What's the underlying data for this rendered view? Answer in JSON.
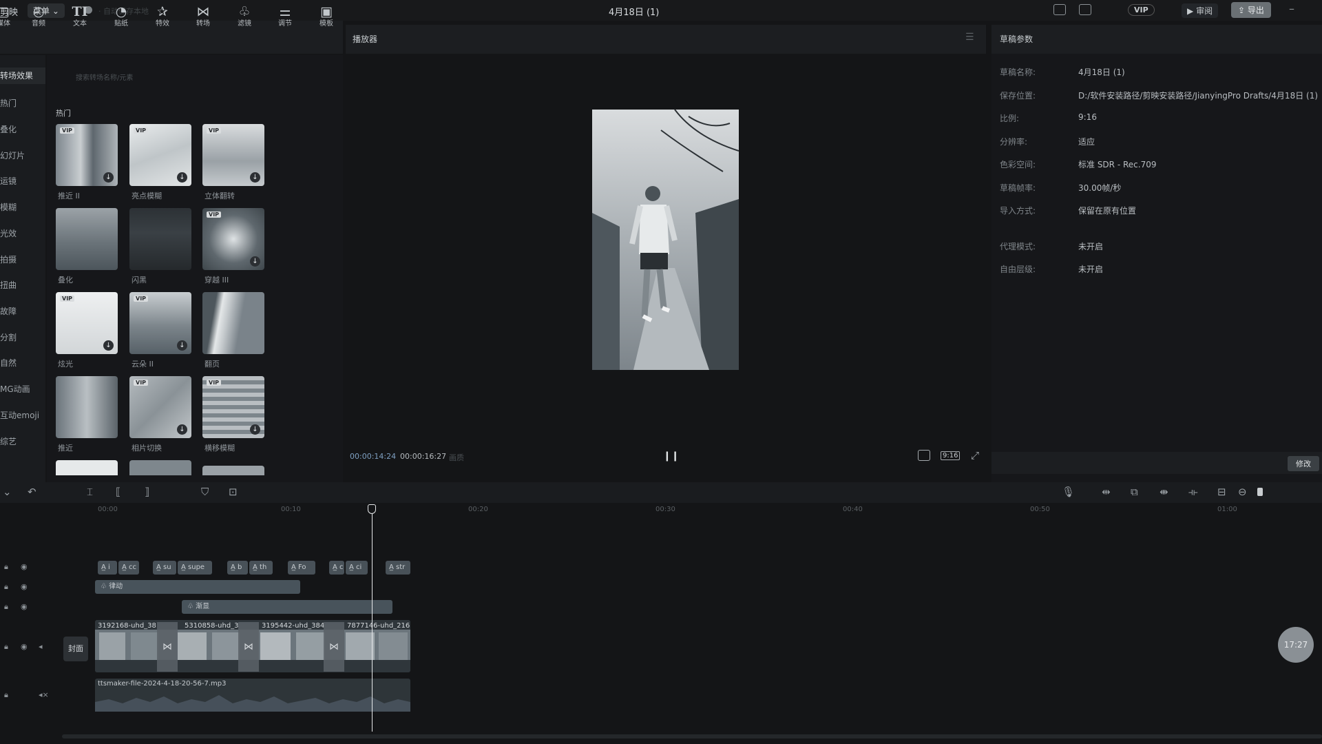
{
  "titlebar": {
    "app_name": "剪映",
    "menu_label": "菜单",
    "status": "· 自动保存本地",
    "project_title": "4月18日 (1)",
    "vip": "VIP",
    "review": "审阅",
    "export": "导出"
  },
  "toolbar": {
    "items": [
      {
        "label": "媒体",
        "icon": "media-icon"
      },
      {
        "label": "音频",
        "icon": "audio-icon"
      },
      {
        "label": "文本",
        "icon": "text-icon"
      },
      {
        "label": "贴纸",
        "icon": "sticker-icon"
      },
      {
        "label": "特效",
        "icon": "effects-icon"
      },
      {
        "label": "转场",
        "icon": "transition-icon"
      },
      {
        "label": "滤镜",
        "icon": "filter-icon"
      },
      {
        "label": "调节",
        "icon": "adjust-icon"
      },
      {
        "label": "模板",
        "icon": "template-icon"
      }
    ]
  },
  "sidebar": {
    "items": [
      "转场效果",
      "热门",
      "叠化",
      "幻灯片",
      "运镜",
      "模糊",
      "光效",
      "拍摄",
      "扭曲",
      "故障",
      "分割",
      "自然",
      "MG动画",
      "互动emoji",
      "综艺"
    ]
  },
  "transitions": {
    "search_hint": "搜索转场名称/元素",
    "section_title": "热门",
    "vip_badge": "VIP",
    "items": [
      {
        "label": "推近 II",
        "vip": true,
        "download": true
      },
      {
        "label": "亮点模糊",
        "vip": true,
        "download": true
      },
      {
        "label": "立体翻转",
        "vip": true,
        "download": true
      },
      {
        "label": "叠化",
        "vip": false,
        "download": false
      },
      {
        "label": "闪黑",
        "vip": false,
        "download": false
      },
      {
        "label": "穿越 III",
        "vip": true,
        "download": true
      },
      {
        "label": "炫光",
        "vip": true,
        "download": true
      },
      {
        "label": "云朵 II",
        "vip": true,
        "download": true
      },
      {
        "label": "翻页",
        "vip": false,
        "download": false
      },
      {
        "label": "推近",
        "vip": false,
        "download": false
      },
      {
        "label": "相片切换",
        "vip": true,
        "download": true
      },
      {
        "label": "横移模糊",
        "vip": true,
        "download": true
      }
    ]
  },
  "player": {
    "title": "播放器",
    "current_time": "00:00:14:24",
    "total_time": "00:00:16:27",
    "extra": "画质",
    "ratio": "9:16"
  },
  "properties": {
    "title": "草稿参数",
    "rows": [
      {
        "label": "草稿名称:",
        "value": "4月18日 (1)"
      },
      {
        "label": "保存位置:",
        "value": "D:/软件安装路径/剪映安装路径/JianyingPro Drafts/4月18日 (1)"
      },
      {
        "label": "比例:",
        "value": "9:16"
      },
      {
        "label": "分辨率:",
        "value": "适应"
      },
      {
        "label": "色彩空间:",
        "value": "标准 SDR - Rec.709"
      },
      {
        "label": "草稿帧率:",
        "value": "30.00帧/秒"
      },
      {
        "label": "导入方式:",
        "value": "保留在原有位置"
      },
      {
        "label": "代理模式:",
        "value": "未开启"
      },
      {
        "label": "自由层级:",
        "value": "未开启"
      }
    ],
    "edit_button": "修改"
  },
  "timeline": {
    "ruler": [
      "00:00",
      "00:10",
      "00:20",
      "00:30",
      "00:40",
      "00:50",
      "01:00"
    ],
    "text_clips": [
      "A̲ i",
      "A̲ cc",
      "A̲ su",
      "A̲ supe",
      "A̲ b",
      "A̲ th",
      "A̲ Fo",
      "A̲ c",
      "A̲ ci",
      "A̲ str"
    ],
    "effect_clips": [
      "律动",
      "渐显"
    ],
    "video_clips": [
      "3192168-uhd_38",
      "5310858-uhd_3",
      "3195442-uhd_384",
      "7877146-uhd_216"
    ],
    "cover_label": "封面",
    "audio_clip": "ttsmaker-file-2024-4-18-20-56-7.mp3",
    "time_bubble": "17:27"
  },
  "colors": {
    "background": "#141517",
    "panel": "#1c1e21",
    "clip": "#485158",
    "accent_timecode": "#7fa0c2"
  }
}
